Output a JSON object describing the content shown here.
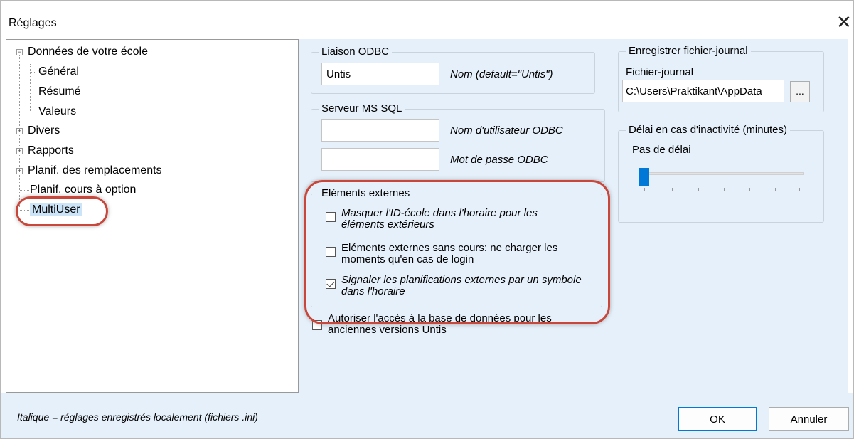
{
  "window": {
    "title": "Réglages",
    "close_icon": "close-icon"
  },
  "tree": {
    "items": [
      {
        "label": "Données de votre école",
        "expander": "−"
      },
      {
        "label": "Général"
      },
      {
        "label": "Résumé"
      },
      {
        "label": "Valeurs"
      },
      {
        "label": "Divers",
        "expander": "+"
      },
      {
        "label": "Rapports",
        "expander": "+"
      },
      {
        "label": "Planif. des remplacements",
        "expander": "+"
      },
      {
        "label": "Planif. cours à option"
      },
      {
        "label": "MultiUser",
        "selected": true
      }
    ]
  },
  "odbc": {
    "title": "Liaison ODBC",
    "name_value": "Untis",
    "name_label": "Nom (default=\"Untis\")"
  },
  "sql": {
    "title": "Serveur MS SQL",
    "user_value": "",
    "user_label": "Nom d'utilisateur ODBC",
    "pwd_value": "",
    "pwd_label": "Mot de passe ODBC"
  },
  "external": {
    "title": "Eléments externes",
    "options": [
      {
        "label": "Masquer l'ID-école dans l'horaire pour les éléments extérieurs",
        "checked": false,
        "italic": true
      },
      {
        "label": "Eléments externes sans cours: ne charger les moments qu'en cas de login",
        "checked": false,
        "italic": false
      },
      {
        "label": "Signaler les planifications externes par un symbole dans l'horaire",
        "checked": true,
        "italic": true
      }
    ]
  },
  "legacy": {
    "label": "Autoriser l'accès à la base de données pour les anciennes versions Untis",
    "checked": false
  },
  "log": {
    "title": "Enregistrer fichier-journal",
    "file_label": "Fichier-journal",
    "file_value": "C:\\Users\\Praktikant\\AppData",
    "browse_label": "..."
  },
  "timeout": {
    "title": "Délai en cas d'inactivité (minutes)",
    "value_label": "Pas de délai",
    "slider_value": 0
  },
  "footer": {
    "note": "Italique = réglages enregistrés localement (fichiers .ini)",
    "ok_label": "OK",
    "cancel_label": "Annuler"
  },
  "colors": {
    "accent": "#0078d7",
    "panel": "#e6f0fa",
    "annotation": "#c8463a",
    "selection": "#cce4f7"
  }
}
